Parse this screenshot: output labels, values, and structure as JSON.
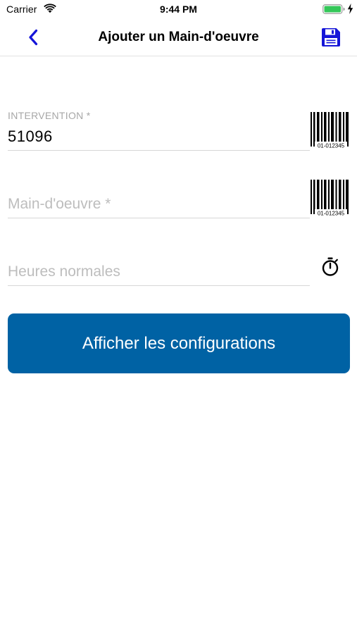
{
  "status_bar": {
    "carrier": "Carrier",
    "time": "9:44 PM",
    "battery_color": "#34c759"
  },
  "nav": {
    "title": "Ajouter un Main-d'oeuvre",
    "back_icon": "chevron-left-icon",
    "save_icon": "floppy-disk-icon",
    "accent_color": "#1515d8"
  },
  "form": {
    "intervention": {
      "label": "INTERVENTION *",
      "value": "51096",
      "scan_icon": "barcode-icon",
      "barcode_caption": "01-012345"
    },
    "main_oeuvre": {
      "placeholder": "Main-d'oeuvre *",
      "value": "",
      "scan_icon": "barcode-icon",
      "barcode_caption": "01-012345"
    },
    "heures_normales": {
      "placeholder": "Heures normales",
      "value": "",
      "timer_icon": "stopwatch-icon"
    }
  },
  "actions": {
    "show_config_label": "Afficher les configurations",
    "button_color": "#0062a4"
  }
}
